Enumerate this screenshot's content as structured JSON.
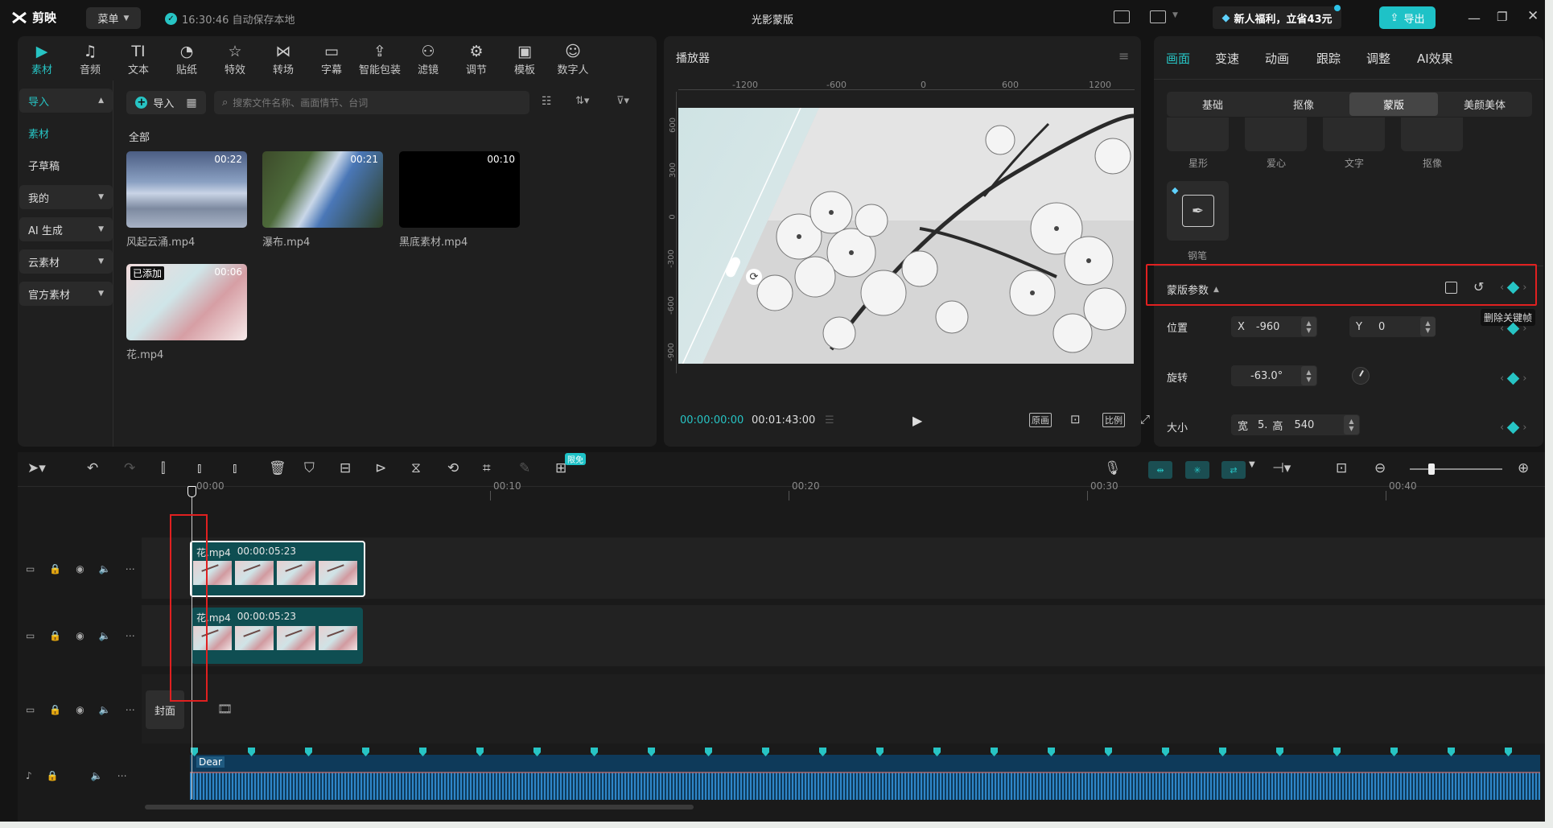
{
  "app": {
    "logo_text": "剪映",
    "menu_label": "菜单",
    "saved_text": "16:30:46 自动保存本地",
    "title": "光影蒙版",
    "promo_text": "新人福利，立省43元",
    "export_label": "导出"
  },
  "toolbar": [
    "素材",
    "音频",
    "文本",
    "贴纸",
    "特效",
    "转场",
    "字幕",
    "智能包装",
    "滤镜",
    "调节",
    "模板",
    "数字人"
  ],
  "sidebar": {
    "import_label": "导入",
    "items": [
      {
        "label": "素材",
        "active": true
      },
      {
        "label": "子草稿"
      },
      {
        "label": "我的"
      },
      {
        "label": "AI 生成"
      },
      {
        "label": "云素材"
      },
      {
        "label": "官方素材"
      }
    ]
  },
  "media": {
    "import_btn": "导入",
    "search_placeholder": "搜索文件名称、画面情节、台词",
    "section_all": "全部",
    "added_badge": "已添加",
    "items": [
      {
        "name": "风起云涌.mp4",
        "duration": "00:22"
      },
      {
        "name": "瀑布.mp4",
        "duration": "00:21"
      },
      {
        "name": "黑底素材.mp4",
        "duration": "00:10"
      },
      {
        "name": "花.mp4",
        "duration": "00:06"
      }
    ]
  },
  "player": {
    "title": "播放器",
    "ruler_h": [
      "-1200",
      "-600",
      "0",
      "600",
      "1200"
    ],
    "ruler_v": [
      "600",
      "300",
      "0",
      "-300",
      "-600",
      "-900"
    ],
    "time_current": "00:00:00:00",
    "time_total": "00:01:43:00",
    "btn_original": "原画",
    "btn_ratio": "比例"
  },
  "right": {
    "tabs": [
      "画面",
      "变速",
      "动画",
      "跟踪",
      "调整",
      "AI效果"
    ],
    "subtabs": [
      "基础",
      "抠像",
      "蒙版",
      "美颜美体"
    ],
    "mask_shapes": [
      "星形",
      "爱心",
      "文字",
      "抠像"
    ],
    "pen_label": "钢笔",
    "mask_params_label": "蒙版参数",
    "tooltip": "删除关键帧",
    "position_label": "位置",
    "x_label": "X",
    "x_value": "-960",
    "y_label": "Y",
    "y_value": "0",
    "rotation_label": "旋转",
    "rotation_value": "-63.0°",
    "size_label": "大小",
    "width_label": "宽",
    "width_value": "5.",
    "height_label": "高",
    "height_value": "540"
  },
  "timeline": {
    "ruler": [
      "00:00",
      "00:10",
      "00:20",
      "00:30",
      "00:40"
    ],
    "clip1_name": "花.mp4",
    "clip1_dur": "00:00:05:23",
    "clip2_name": "花.mp4",
    "clip2_dur": "00:00:05:23",
    "cover_label": "封面",
    "audio_name": "Dear",
    "badge": "限免"
  }
}
